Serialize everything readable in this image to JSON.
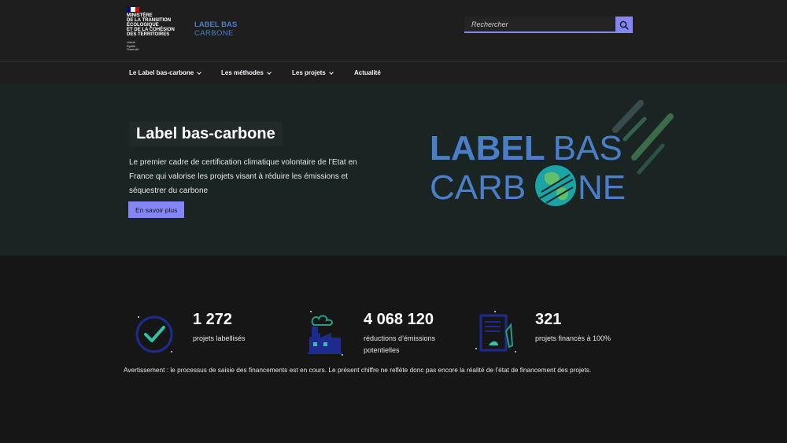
{
  "header": {
    "ministry_lines": [
      "Ministère",
      "de la Transition",
      "écologique",
      "et de la Cohésion",
      "des territoires"
    ],
    "motto_lines": [
      "Liberté",
      "Égalité",
      "Fraternité"
    ],
    "flag_colors": [
      "#000091",
      "#ffffff",
      "#e1000f"
    ],
    "small_logo_line1": "LABEL BAS",
    "small_logo_line2": "CARBONE",
    "search_placeholder": "Rechercher",
    "search_icon": "search-icon"
  },
  "nav": {
    "items": [
      {
        "label": "Le Label bas-carbone",
        "has_dropdown": true
      },
      {
        "label": "Les méthodes",
        "has_dropdown": true
      },
      {
        "label": "Les projets",
        "has_dropdown": true
      },
      {
        "label": "Actualité",
        "has_dropdown": false
      }
    ]
  },
  "hero": {
    "title": "Label bas-carbone",
    "description": "Le premier cadre de certification climatique volontaire de l’Etat en France qui valorise les projets visant à réduire les émissions et séquestrer du carbone",
    "button_label": "En savoir plus",
    "logo_line1": "LABEL BAS",
    "logo_line2_pre": "CARB",
    "logo_line2_post": "NE"
  },
  "stats": {
    "items": [
      {
        "value": "1 272",
        "label": "projets labellisés",
        "icon": "check-circle-icon"
      },
      {
        "value": "4 068 120",
        "label": "réductions d’émissions potentielles",
        "icon": "factory-icon"
      },
      {
        "value": "321",
        "label": "projets financés à 100%",
        "icon": "document-plant-icon"
      }
    ],
    "warning": "Avertissement : le processus de saisie des financements est en cours. Le présent chiffre ne reflète donc pas encore la réalité de l’état de financement des projets."
  },
  "colors": {
    "accent": "#8585f6",
    "logo_blue": "#4a7ec6",
    "hero_bg": "#1a2523",
    "page_bg": "#161616"
  }
}
